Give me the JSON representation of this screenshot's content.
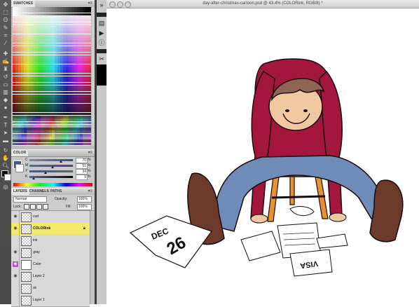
{
  "window": {
    "title": "day-after-christmas-cartoon.psd @ 43.4% (COLORink, RGB/8) *",
    "doc_icon": "document-icon"
  },
  "tools": [
    "move-tool-icon",
    "marquee-tool-icon",
    "lasso-tool-icon",
    "quick-select-icon",
    "crop-tool-icon",
    "eyedropper-icon",
    "healing-brush-icon",
    "brush-tool-icon",
    "clone-stamp-icon",
    "history-brush-icon",
    "eraser-icon",
    "gradient-icon",
    "blur-icon",
    "dodge-icon",
    "pen-tool-icon",
    "type-tool-icon",
    "path-select-icon",
    "shape-tool-icon",
    "3d-rotate-icon",
    "3d-orbit-icon",
    "hand-tool-icon",
    "zoom-tool-icon"
  ],
  "swatches": {
    "tab": "SWATCHES",
    "menu": "▾≡"
  },
  "color": {
    "tab": "COLOR",
    "menu": "▾≡",
    "fg_color": "#3a5a8c",
    "channels": [
      {
        "label": "C",
        "value": "70",
        "unit": "%"
      },
      {
        "label": "M",
        "value": "51",
        "unit": "%"
      },
      {
        "label": "Y",
        "value": "34",
        "unit": "%"
      },
      {
        "label": "K",
        "value": "9",
        "unit": "%"
      }
    ]
  },
  "layers_panel": {
    "tabs": [
      "LAYERS",
      "CHANNELS",
      "PATHS"
    ],
    "menu": "▾≡",
    "blend_mode": "Normal",
    "opacity_label": "Opacity:",
    "opacity_value": "100%",
    "lock_label": "Lock:",
    "fill_label": "Fill:",
    "fill_value": "100%",
    "layers": [
      {
        "name": "cud",
        "visible": true,
        "active": false,
        "locked": false
      },
      {
        "name": "COLORink",
        "visible": true,
        "active": true,
        "locked": true
      },
      {
        "name": "ink",
        "visible": false,
        "active": false,
        "locked": false
      },
      {
        "name": "gray",
        "visible": true,
        "active": false,
        "locked": false
      },
      {
        "name": "Color",
        "visible": true,
        "active": false,
        "locked": false
      },
      {
        "name": "Layer 2",
        "visible": true,
        "active": false,
        "locked": false
      },
      {
        "name": "sk",
        "visible": false,
        "active": false,
        "locked": false
      },
      {
        "name": "Layer 1",
        "visible": false,
        "active": false,
        "locked": false
      }
    ]
  },
  "side_strip_icons": [
    "double-arrow-icon",
    "history-icon",
    "actions-icon",
    "info-icon",
    "character-icon",
    "tools-preset-icon"
  ],
  "artwork": {
    "calendar_text": "DEC",
    "calendar_day": "26",
    "receipt_text": "VISA",
    "shirt_color": "#a3173e",
    "jeans_color": "#6f8bb8",
    "stool_color": "#e8912f"
  }
}
